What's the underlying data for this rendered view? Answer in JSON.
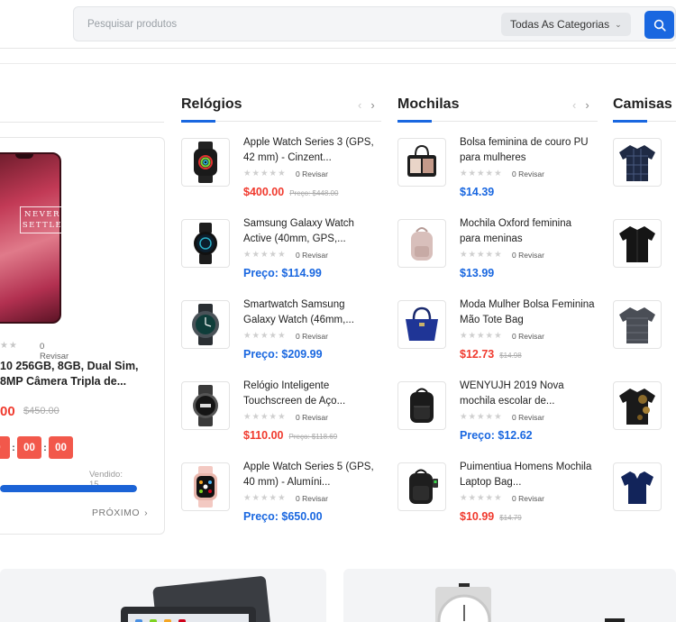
{
  "search": {
    "placeholder": "Pesquisar produtos",
    "category": "Todas As Categorias"
  },
  "deal": {
    "phone_text_1": "NEVER",
    "phone_text_2": "SETTLE",
    "stars": "★★",
    "reviews": "0 Revisar",
    "title": "10 256GB, 8GB, Dual Sim, 8MP Câmera Tripla de...",
    "price": "00",
    "old_price": "$450.00",
    "timer": [
      "0",
      "00",
      "00"
    ],
    "sold": "Vendido: 15",
    "progress": 1.0,
    "next": "PRÓXIMO",
    "colors": {
      "accent": "#1967e0",
      "sale": "#f03a2e",
      "timer": "#f2584b"
    }
  },
  "columns": [
    {
      "title": "Relógios",
      "items": [
        {
          "name": "Apple Watch Series 3 (GPS, 42 mm) - Cinzent...",
          "stars": "★★★★★",
          "reviews": "0 Revisar",
          "price": "$400.00",
          "old": "Preço: $448.00",
          "price_color": "red",
          "icon": "apple-watch-black-icon"
        },
        {
          "name": "Samsung Galaxy Watch Active (40mm, GPS,...",
          "stars": "★★★★★",
          "reviews": "0 Revisar",
          "price": "Preço: $114.99",
          "old": "",
          "price_color": "blue",
          "icon": "galaxy-watch-active-icon"
        },
        {
          "name": "Smartwatch Samsung Galaxy Watch (46mm,...",
          "stars": "★★★★★",
          "reviews": "0 Revisar",
          "price": "Preço: $209.99",
          "old": "",
          "price_color": "blue",
          "icon": "galaxy-watch-icon"
        },
        {
          "name": "Relógio Inteligente Touchscreen de Aço...",
          "stars": "★★★★★",
          "reviews": "0 Revisar",
          "price": "$110.00",
          "old": "Preço: $118.69",
          "price_color": "red",
          "icon": "smartwatch-steel-icon"
        },
        {
          "name": "Apple Watch Series 5 (GPS, 40 mm) - Alumíni...",
          "stars": "★★★★★",
          "reviews": "0 Revisar",
          "price": "Preço: $650.00",
          "old": "",
          "price_color": "blue",
          "icon": "apple-watch-pink-icon"
        }
      ]
    },
    {
      "title": "Mochilas",
      "items": [
        {
          "name": "Bolsa feminina de couro PU para mulheres",
          "stars": "★★★★★",
          "reviews": "0 Revisar",
          "price": "$14.39",
          "old": "",
          "price_color": "blue",
          "icon": "leather-handbag-icon"
        },
        {
          "name": "Mochila Oxford feminina para meninas",
          "stars": "★★★★★",
          "reviews": "0 Revisar",
          "price": "$13.99",
          "old": "",
          "price_color": "blue",
          "icon": "pink-backpack-icon"
        },
        {
          "name": "Moda Mulher Bolsa Feminina Mão Tote Bag",
          "stars": "★★★★★",
          "reviews": "0 Revisar",
          "price": "$12.73",
          "old": "$14.98",
          "price_color": "red",
          "icon": "blue-tote-bag-icon"
        },
        {
          "name": "WENYUJH 2019 Nova mochila escolar de...",
          "stars": "★★★★★",
          "reviews": "0 Revisar",
          "price": "Preço: $12.62",
          "old": "",
          "price_color": "blue",
          "icon": "school-backpack-icon"
        },
        {
          "name": "Puimentiua Homens Mochila Laptop Bag...",
          "stars": "★★★★★",
          "reviews": "0 Revisar",
          "price": "$10.99",
          "old": "$14.79",
          "price_color": "red",
          "icon": "laptop-backpack-icon"
        }
      ]
    },
    {
      "title": "Camisas",
      "items": [
        {
          "icon": "plaid-shirt-icon"
        },
        {
          "icon": "black-shirt-icon"
        },
        {
          "icon": "grey-shirt-icon"
        },
        {
          "icon": "camo-shirt-icon"
        },
        {
          "icon": "navy-polo-icon"
        }
      ]
    }
  ]
}
